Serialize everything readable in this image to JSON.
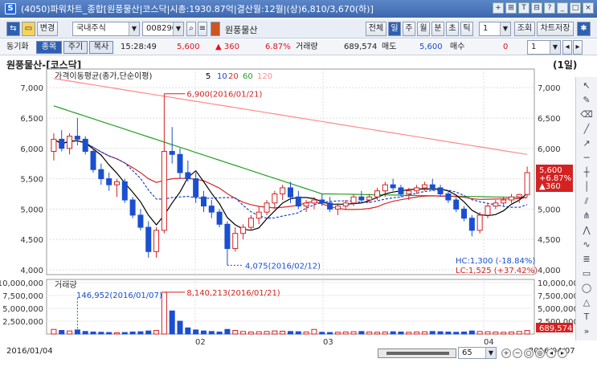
{
  "window": {
    "title": "(4050)파워차트_종합[원풍물산|코스닥|시총:1930.87억|결산월:12월|(상)6,810/3,670(하)]",
    "buttons": [
      "+",
      "⊞",
      "T",
      "⊟",
      "?",
      "_",
      "□",
      "×"
    ]
  },
  "toolbar": {
    "change_label": "변경",
    "market": "국내주식",
    "code": "008290",
    "stock_name": "원풍물산",
    "periods": [
      "전체",
      "일",
      "주",
      "월",
      "분",
      "초",
      "틱"
    ],
    "active_period": "일",
    "period_count": "1",
    "lookup": "조회",
    "save": "차트저장"
  },
  "quote": {
    "label": "동기화",
    "tabs": [
      "종목",
      "주기",
      "복사"
    ],
    "time": "15:28:49",
    "price": "5,600",
    "change": "▲ 360",
    "rate": "6.87%",
    "vol_label": "거래량",
    "volume": "689,574",
    "sell_label": "매도",
    "sell": "5,600",
    "buy_label": "매수",
    "buy": "0",
    "count": "1"
  },
  "chart": {
    "title": "원풍물산-[코스닥]",
    "period_tag": "(1일)",
    "ma_legend": "가격이동평균(종가,단순이평)",
    "ma_periods": [
      "5",
      "10",
      "20",
      "60",
      "120"
    ],
    "colors": {
      "ma5": "#000000",
      "ma10": "#1a3fc8",
      "ma20": "#d42a2a",
      "ma60": "#22a022",
      "ma120": "#ff8a8a",
      "up": "#d42222",
      "down": "#1a4fd0"
    },
    "max_label": "6,900(2016/01/21)",
    "min_label": "4,075(2016/02/12)",
    "hc": "HC:1,300 (-18.84%)",
    "lc": "LC:1,525 (+37.42%)",
    "price_ticks": [
      "7,000",
      "6,500",
      "6,000",
      "5,500",
      "5,000",
      "4,500",
      "4,000"
    ],
    "last_price": "5,600",
    "last_rate": "+6.87%",
    "last_change": "▲360"
  },
  "volume": {
    "title": "거래량",
    "max_label": "8,140,213(2016/01/21)",
    "min_label": "146,952(2016/01/07)",
    "ticks": [
      "10,000,000",
      "7,500,000",
      "5,000,000",
      "2,500,000"
    ],
    "unit": "10,000,000",
    "right_ticks": [
      "7,500,000",
      "5,000,000",
      "2,500,000"
    ],
    "last": "689,574"
  },
  "xaxis": {
    "start": "2016/01/04",
    "labels": [
      "02",
      "03",
      "04"
    ],
    "end": "2016/04/07",
    "zoom": "65"
  },
  "chart_data": {
    "type": "candlestick",
    "x": [
      "2016/01/04",
      "2016/04/07"
    ],
    "ylim": [
      4000,
      7200
    ],
    "ohlc": [
      [
        5950,
        6250,
        5800,
        6150
      ],
      [
        6150,
        6300,
        5950,
        6000
      ],
      [
        6000,
        6250,
        5900,
        6200
      ],
      [
        6200,
        6500,
        6050,
        6150
      ],
      [
        6150,
        6200,
        5900,
        5950
      ],
      [
        5950,
        6000,
        5600,
        5650
      ],
      [
        5650,
        5750,
        5400,
        5500
      ],
      [
        5500,
        5600,
        5300,
        5400
      ],
      [
        5400,
        5500,
        5200,
        5450
      ],
      [
        5450,
        5500,
        5100,
        5150
      ],
      [
        5150,
        5200,
        4850,
        4900
      ],
      [
        4900,
        5000,
        4650,
        4700
      ],
      [
        4700,
        4800,
        4200,
        4300
      ],
      [
        4300,
        4700,
        4200,
        4650
      ],
      [
        4650,
        6900,
        4600,
        5950
      ],
      [
        5950,
        6350,
        5750,
        5900
      ],
      [
        5900,
        6000,
        5500,
        5600
      ],
      [
        5600,
        5800,
        5450,
        5500
      ],
      [
        5500,
        5600,
        5100,
        5200
      ],
      [
        5200,
        5300,
        4950,
        5050
      ],
      [
        5050,
        5150,
        4850,
        4950
      ],
      [
        4950,
        5000,
        4700,
        4750
      ],
      [
        4750,
        4800,
        4075,
        4350
      ],
      [
        4350,
        4700,
        4300,
        4600
      ],
      [
        4600,
        4750,
        4500,
        4700
      ],
      [
        4700,
        4900,
        4650,
        4850
      ],
      [
        4850,
        5050,
        4750,
        4950
      ],
      [
        4950,
        5150,
        4900,
        5100
      ],
      [
        5100,
        5300,
        5000,
        5250
      ],
      [
        5250,
        5400,
        5150,
        5350
      ],
      [
        5350,
        5450,
        5100,
        5200
      ],
      [
        5200,
        5300,
        5000,
        5050
      ],
      [
        5050,
        5150,
        4950,
        5100
      ],
      [
        5100,
        5200,
        5000,
        5150
      ],
      [
        5150,
        5250,
        5050,
        5100
      ],
      [
        5100,
        5200,
        4950,
        5000
      ],
      [
        5000,
        5100,
        4900,
        5050
      ],
      [
        5050,
        5150,
        5000,
        5100
      ],
      [
        5100,
        5250,
        5050,
        5200
      ],
      [
        5200,
        5300,
        5100,
        5150
      ],
      [
        5150,
        5250,
        5100,
        5200
      ],
      [
        5200,
        5350,
        5150,
        5300
      ],
      [
        5300,
        5450,
        5200,
        5400
      ],
      [
        5400,
        5500,
        5300,
        5350
      ],
      [
        5350,
        5400,
        5200,
        5250
      ],
      [
        5250,
        5350,
        5150,
        5300
      ],
      [
        5300,
        5400,
        5250,
        5350
      ],
      [
        5350,
        5450,
        5300,
        5400
      ],
      [
        5400,
        5500,
        5300,
        5350
      ],
      [
        5350,
        5400,
        5200,
        5250
      ],
      [
        5250,
        5300,
        5100,
        5150
      ],
      [
        5150,
        5200,
        4950,
        5000
      ],
      [
        5000,
        5050,
        4800,
        4850
      ],
      [
        4850,
        4900,
        4550,
        4650
      ],
      [
        4650,
        4950,
        4600,
        4900
      ],
      [
        4900,
        5100,
        4850,
        5050
      ],
      [
        5050,
        5150,
        5000,
        5100
      ],
      [
        5100,
        5200,
        5050,
        5150
      ],
      [
        5150,
        5250,
        5100,
        5200
      ],
      [
        5200,
        5250,
        5100,
        5240
      ],
      [
        5240,
        5700,
        5200,
        5600
      ]
    ],
    "volume": [
      900000,
      700000,
      600000,
      800000,
      500000,
      400000,
      350000,
      300000,
      250000,
      300000,
      400000,
      450000,
      600000,
      700000,
      8140213,
      4500000,
      2500000,
      1200000,
      800000,
      600000,
      500000,
      400000,
      900000,
      700000,
      500000,
      400000,
      450000,
      500000,
      600000,
      550000,
      500000,
      450000,
      400000,
      900000,
      350000,
      300000,
      350000,
      400000,
      450000,
      500000,
      400000,
      350000,
      400000,
      450000,
      400000,
      350000,
      400000,
      450000,
      500000,
      450000,
      400000,
      350000,
      400000,
      600000,
      500000,
      450000,
      400000,
      350000,
      400000,
      500000,
      689574
    ]
  }
}
